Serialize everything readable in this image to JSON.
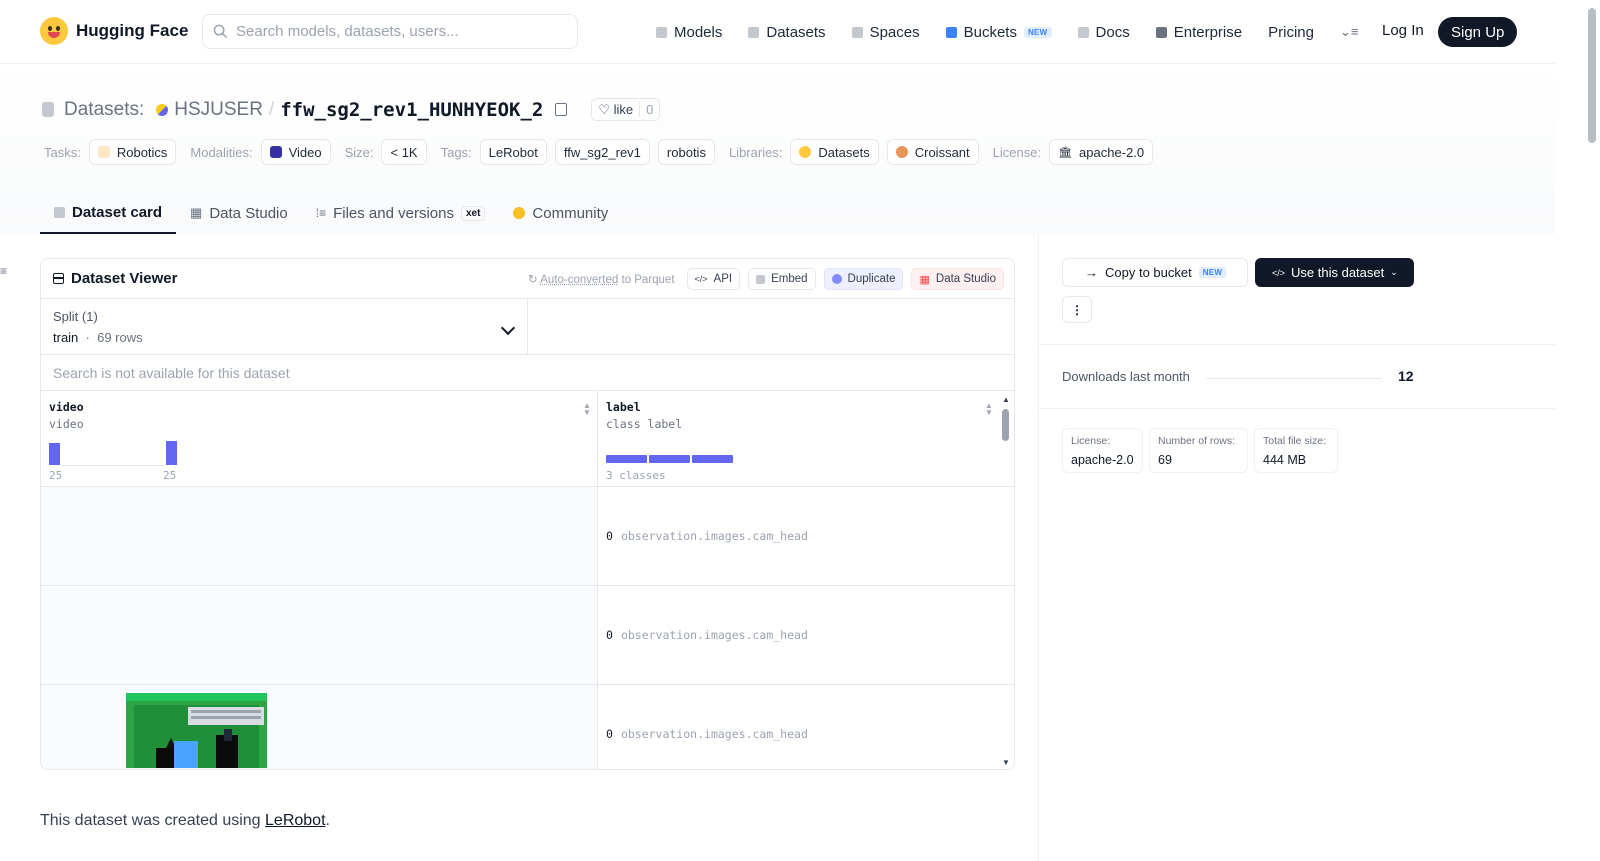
{
  "header": {
    "logo_text": "Hugging Face",
    "search_placeholder": "Search models, datasets, users...",
    "nav": [
      {
        "label": "Models",
        "icon": "cube-icon"
      },
      {
        "label": "Datasets",
        "icon": "database-icon"
      },
      {
        "label": "Spaces",
        "icon": "grid-icon"
      },
      {
        "label": "Buckets",
        "icon": "bucket-icon",
        "badge": "NEW"
      },
      {
        "label": "Docs",
        "icon": "book-icon"
      },
      {
        "label": "Enterprise",
        "icon": "enterprise-icon"
      },
      {
        "label": "Pricing"
      }
    ],
    "login": "Log In",
    "signup": "Sign Up"
  },
  "title": {
    "prefix": "Datasets:",
    "org": "HSJUSER",
    "separator": "/",
    "name": "ffw_sg2_rev1_HUNHYEOK_2",
    "like_label": "like",
    "like_count": "0"
  },
  "tags": {
    "tasks_label": "Tasks:",
    "tasks": "Robotics",
    "modalities_label": "Modalities:",
    "modalities": "Video",
    "size_label": "Size:",
    "size": "< 1K",
    "tags_label": "Tags:",
    "tag_items": [
      "LeRobot",
      "ffw_sg2_rev1",
      "robotis"
    ],
    "libraries_label": "Libraries:",
    "libraries": [
      "Datasets",
      "Croissant"
    ],
    "license_label": "License:",
    "license": "apache-2.0"
  },
  "tabs": [
    {
      "label": "Dataset card",
      "active": true
    },
    {
      "label": "Data Studio"
    },
    {
      "label": "Files and versions",
      "badge": "xet"
    },
    {
      "label": "Community"
    }
  ],
  "viewer": {
    "title": "Dataset Viewer",
    "auto_converted_link": "Auto-converted",
    "auto_converted_suffix": "to Parquet",
    "api": "API",
    "embed": "Embed",
    "duplicate": "Duplicate",
    "data_studio": "Data Studio",
    "split_label": "Split (1)",
    "split_value": "train",
    "split_rows": "69 rows",
    "search_disabled": "Search is not available for this dataset",
    "columns": [
      {
        "name": "video",
        "type": "video",
        "hist_labels": [
          "25",
          "25"
        ]
      },
      {
        "name": "label",
        "type": "class label",
        "summary": "3 classes"
      }
    ],
    "rows": [
      {
        "label_id": "0",
        "label_name": "observation.images.cam_head"
      },
      {
        "label_id": "0",
        "label_name": "observation.images.cam_head"
      },
      {
        "label_id": "0",
        "label_name": "observation.images.cam_head"
      }
    ]
  },
  "card_text": {
    "prefix": "This dataset was created using ",
    "link": "LeRobot",
    "suffix": "."
  },
  "sidebar": {
    "copy_bucket": "Copy to bucket",
    "copy_bucket_badge": "NEW",
    "use_dataset": "Use this dataset",
    "downloads_label": "Downloads last month",
    "downloads_value": "12",
    "stats": [
      {
        "k": "License:",
        "v": "apache-2.0"
      },
      {
        "k": "Number of rows:",
        "v": "69"
      },
      {
        "k": "Total file size:",
        "v": "444 MB"
      }
    ]
  },
  "colors": {
    "accent": "#6366f1",
    "dark": "#111827",
    "border": "#e5e7eb"
  }
}
